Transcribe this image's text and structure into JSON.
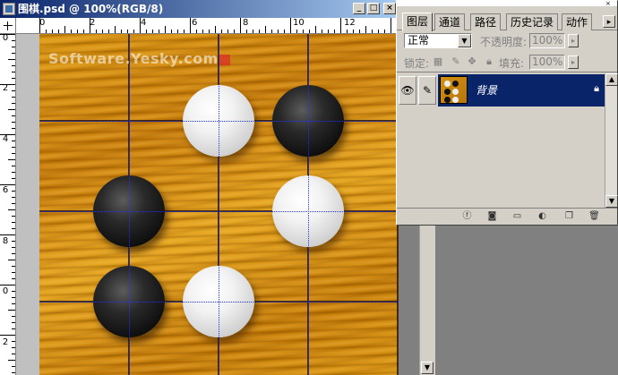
{
  "document": {
    "title": "围棋.psd @ 100%(RGB/8)",
    "minimize": "_",
    "maximize": "□",
    "close": "×",
    "ruler_h_labels": [
      "0",
      "2",
      "4",
      "6",
      "8",
      "10",
      "12"
    ],
    "ruler_v_labels": [
      "0",
      "2",
      "4",
      "6",
      "8",
      "0",
      "2"
    ],
    "watermark": "Software.Yesky.com"
  },
  "board": {
    "stones": [
      {
        "color": "white",
        "col": 2,
        "row": 1
      },
      {
        "color": "black",
        "col": 3,
        "row": 1
      },
      {
        "color": "black",
        "col": 1,
        "row": 2
      },
      {
        "color": "white",
        "col": 3,
        "row": 2
      },
      {
        "color": "black",
        "col": 1,
        "row": 3
      },
      {
        "color": "white",
        "col": 2,
        "row": 3
      }
    ]
  },
  "layers_panel": {
    "tabs": [
      {
        "label": "图层",
        "active": true
      },
      {
        "label": "通道",
        "active": false
      },
      {
        "label": "路径",
        "active": false
      },
      {
        "label": "历史记录",
        "active": false
      },
      {
        "label": "动作",
        "active": false
      }
    ],
    "menu_arrow": "▸",
    "blend_mode": "正常",
    "opacity_label": "不透明度:",
    "opacity_value": "100%",
    "lock_label": "锁定:",
    "fill_label": "填充:",
    "fill_value": "100%",
    "layer": {
      "name": "背景",
      "visible_icon": "eye-icon",
      "brush_icon": "brush-icon",
      "locked": true
    },
    "footer_icons": [
      "link-icon",
      "layer-style-icon",
      "mask-icon",
      "folder-icon",
      "adjustment-icon",
      "new-layer-icon",
      "trash-icon"
    ]
  },
  "colors": {
    "titlebar_start": "#0a246a",
    "titlebar_end": "#a6caf0",
    "selection": "#0a246a",
    "guide": "#2030ff"
  }
}
